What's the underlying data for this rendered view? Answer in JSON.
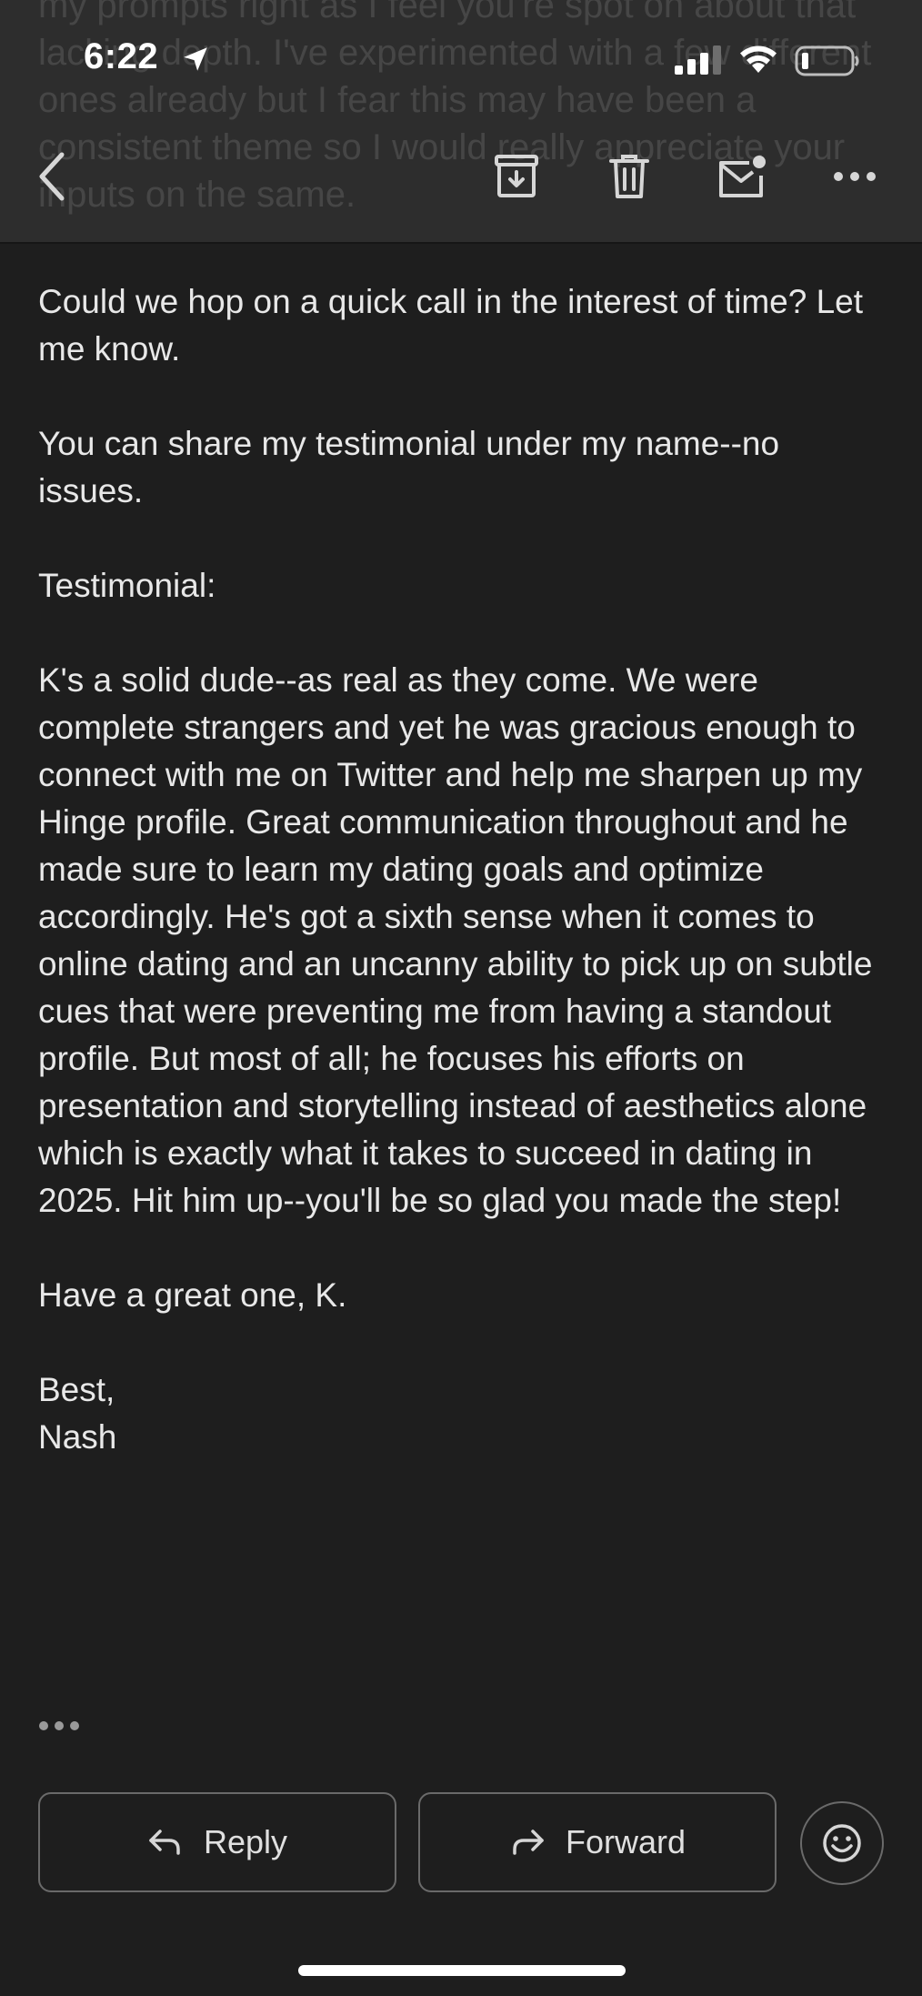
{
  "status_bar": {
    "time": "6:22",
    "icons": [
      "location-arrow-icon",
      "cellular-signal-icon",
      "wifi-icon",
      "battery-icon"
    ]
  },
  "header": {
    "background_text": "my prompts right as I feel you're spot on about that lacking depth. I've experimented with a few different ones already but I fear this may have been a consistent theme so I would really appreciate your inputs on the same.",
    "icons": [
      "chevron-left-icon",
      "archive-icon",
      "trash-icon",
      "mail-unread-icon",
      "more-horizontal-icon"
    ]
  },
  "email": {
    "paragraphs": [
      "Could we hop on a quick call in the interest of time? Let me know.",
      "You can share my testimonial under my name--no issues.",
      "Testimonial:",
      "K's a solid dude--as real as they come. We were complete strangers and yet he was gracious enough to connect with me on Twitter and help me sharpen up my Hinge profile. Great communication throughout and he made sure to learn my dating goals and optimize accordingly. He's got a sixth sense when it comes to online dating and an uncanny ability to pick up on subtle cues that were preventing me from having a standout profile. But most of all; he focuses his efforts on presentation and storytelling instead of aesthetics alone which is exactly what it takes to succeed in dating in 2025. Hit him up--you'll be so glad you made the step!",
      "Have a great one, K."
    ],
    "signoff": "Best,",
    "signature": "Nash"
  },
  "actions": {
    "reply_label": "Reply",
    "forward_label": "Forward"
  },
  "colors": {
    "background": "#1e1e1e",
    "header_background": "#2e2e2e",
    "text": "#e8e8e8",
    "button_border": "#6a6a6a"
  }
}
